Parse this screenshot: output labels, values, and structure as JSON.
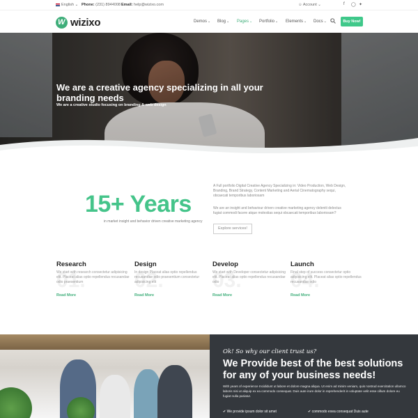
{
  "topbar": {
    "language": "English",
    "phone_label": "Phone:",
    "phone": "(231) 8944008",
    "email_label": "Email:",
    "email": "help@wizixo.com",
    "account": "Account",
    "social_icons": [
      "facebook-icon",
      "instagram-icon",
      "twitter-icon"
    ]
  },
  "header": {
    "logo": "wizixo",
    "nav": [
      {
        "label": "Demos",
        "active": false
      },
      {
        "label": "Blog",
        "active": false
      },
      {
        "label": "Pages",
        "active": true
      },
      {
        "label": "Portfolio",
        "active": false
      },
      {
        "label": "Elements",
        "active": false
      },
      {
        "label": "Docs",
        "active": false
      }
    ],
    "buy_label": "Buy Now!"
  },
  "hero": {
    "title": "We are a creative agency specializing in all your branding needs",
    "subtitle": "We are a creative studio focusing on branding & web design"
  },
  "about": {
    "years": "15+ Years",
    "years_caption": "in market insight and behavior driven creative marketing agency",
    "paragraph_1": "A Full portfolio Digital Creative Agency Specializing in: Video Production, Web Design, Branding, Brand Strategy, Content Marketing and Aerial Cinematography sequi, obcaecati temporibus laboriosam",
    "paragraph_2": "We are an insight and behaviour driven creative marketing agency deleniti delectus fugiat commodi facere atque molestias sequi obcaecati temporibus laboriosam?",
    "explore_label": "Explore services!"
  },
  "services": [
    {
      "number": "01.",
      "title": "Research",
      "text": "We start with research consectetur adipisicing elit. Placeat alias optio repellendus recusandae odio praesentium",
      "link": "Read More"
    },
    {
      "number": "02.",
      "title": "Design",
      "text": "In design Placeat alias optio repellendus recusandae odio praesentium consectetur adipisicing elit",
      "link": "Read More"
    },
    {
      "number": "03.",
      "title": "Develop",
      "text": "We start with Developer consectetur adipisicing elit. Placeat alias optio repellendus recusandae odio",
      "link": "Read More"
    },
    {
      "number": "04.",
      "title": "Launch",
      "text": "Final step of success consectetur optio adipisicing elit. Placeat alias optio repellendus recusandae odio",
      "link": "Read More"
    }
  ],
  "trust": {
    "kicker": "Ok! So why our client trust us?",
    "heading": "We Provide best of the best solutions for any of your business needs!",
    "description": "With years of experience Incididunt ut labore et dolore magna aliqua. Ut enim ad minim veniam, quis nostrud exercitation ullamco laboris nisi ut aliquip ex ea commodo consequat. Duis aute irure dolor in reprehenderit in voluptate velit esse cillum dolore eu fugiat nulla pariatur.",
    "checks": [
      "We provide ipsum dolor sit amet",
      "commodo exea consequat Duis aute"
    ]
  },
  "colors": {
    "accent": "#3fae7a",
    "years_green": "#45c48a",
    "dark_panel": "#34383d"
  }
}
